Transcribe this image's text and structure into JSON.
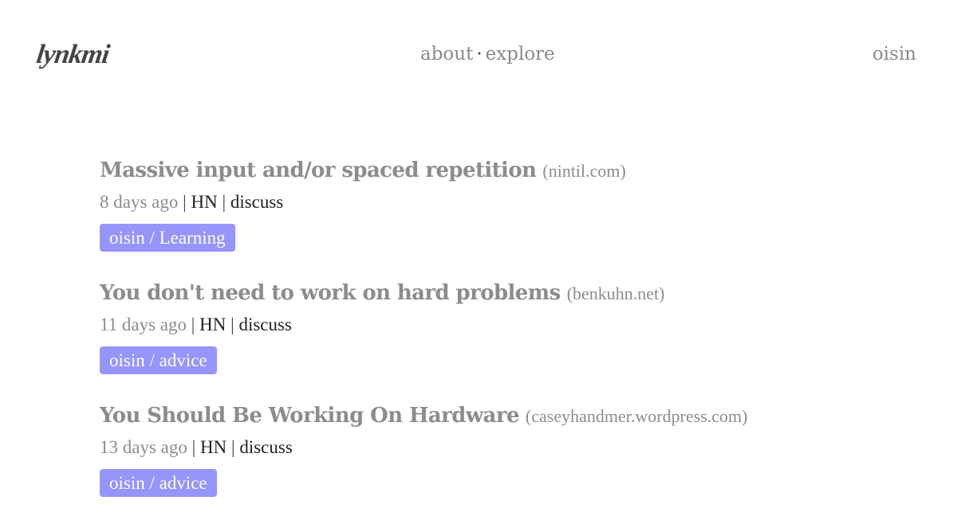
{
  "header": {
    "logo": "lynkmi",
    "nav": [
      {
        "label": "about"
      },
      {
        "label": "explore"
      }
    ],
    "nav_separator": "·",
    "user": "oisin"
  },
  "items": [
    {
      "title": "Massive input and/or spaced repetition",
      "domain": "(nintil.com)",
      "time": "8 days ago",
      "hn": "HN",
      "discuss": "discuss",
      "tag": "oisin / Learning"
    },
    {
      "title": "You don't need to work on hard problems",
      "domain": "(benkuhn.net)",
      "time": "11 days ago",
      "hn": "HN",
      "discuss": "discuss",
      "tag": "oisin / advice"
    },
    {
      "title": "You Should Be Working On Hardware",
      "domain": "(caseyhandmer.wordpress.com)",
      "time": "13 days ago",
      "hn": "HN",
      "discuss": "discuss",
      "tag": "oisin / advice"
    }
  ],
  "separator": "|",
  "colors": {
    "tag_background": "#9595fb",
    "muted_text": "#8c8c8c",
    "body_text": "#222222"
  }
}
